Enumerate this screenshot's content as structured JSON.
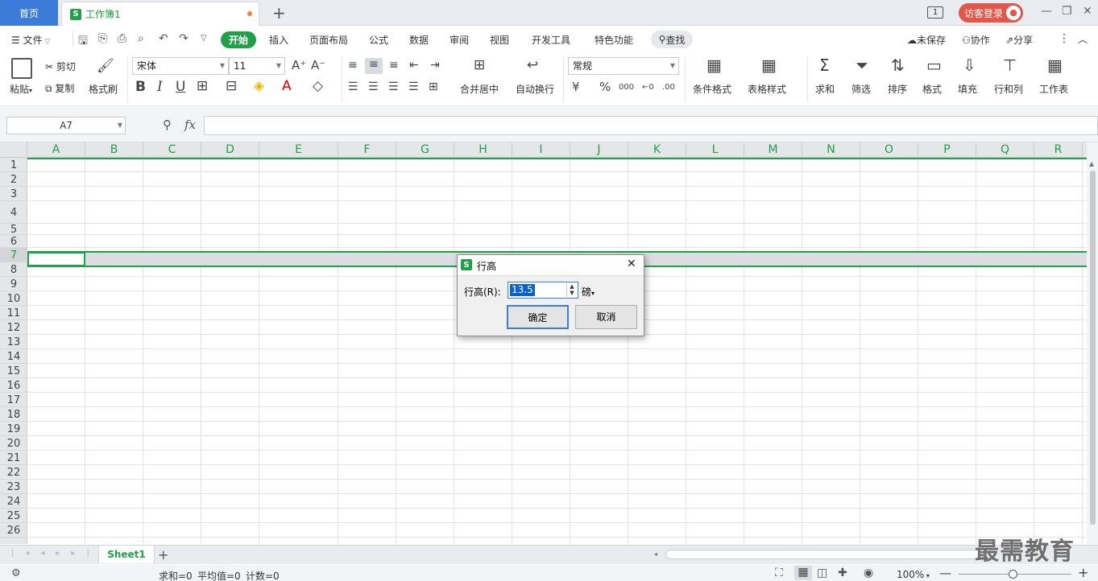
{
  "titlebar": {
    "home_tab": "首页",
    "workbook_tab": "工作簿1",
    "add": "+",
    "guest_login": "访客登录",
    "page_indicator": "1"
  },
  "menu": {
    "file": "文件",
    "start": "开始",
    "insert": "插入",
    "page_layout": "页面布局",
    "formula": "公式",
    "data": "数据",
    "review": "审阅",
    "view": "视图",
    "developer": "开发工具",
    "special": "特色功能",
    "find": "查找",
    "unsaved": "未保存",
    "collab": "协作",
    "share": "分享"
  },
  "ribbon": {
    "paste": "粘贴",
    "cut": "剪切",
    "copy": "复制",
    "format_painter": "格式刷",
    "font_name": "宋体",
    "font_size": "11",
    "merge_center": "合并居中",
    "wrap_text": "自动换行",
    "number_format": "常规",
    "currency": "¥",
    "percent": "%",
    "thousands": "000",
    "cond_format": "条件格式",
    "table_style": "表格样式",
    "sum": "求和",
    "filter": "筛选",
    "sort": "排序",
    "format": "格式",
    "fill": "填充",
    "row_col": "行和列",
    "worksheet": "工作表",
    "bold": "B",
    "italic": "I",
    "underline": "U"
  },
  "formula_bar": {
    "name_box": "A7",
    "fx": "fx"
  },
  "columns": [
    "A",
    "B",
    "C",
    "D",
    "E",
    "F",
    "G",
    "H",
    "I",
    "J",
    "K",
    "L",
    "M",
    "N",
    "O",
    "P",
    "Q",
    "R"
  ],
  "rows": [
    "1",
    "2",
    "3",
    "4",
    "5",
    "6",
    "7",
    "8",
    "9",
    "10",
    "11",
    "12",
    "13",
    "14",
    "15",
    "16",
    "17",
    "18",
    "19",
    "20",
    "21",
    "22",
    "23",
    "24",
    "25",
    "26"
  ],
  "dialog": {
    "title": "行高",
    "label": "行高(R):",
    "value": "13.5",
    "unit": "磅",
    "ok": "确定",
    "cancel": "取消"
  },
  "sheets": {
    "sheet1": "Sheet1",
    "add": "+"
  },
  "status": {
    "sum": "求和=0",
    "avg": "平均值=0",
    "count": "计数=0",
    "zoom": "100%"
  },
  "watermark": "最需教育",
  "colors": {
    "accent": "#21a04a",
    "home_tab": "#3d7bd9",
    "guest": "#e0584a"
  }
}
